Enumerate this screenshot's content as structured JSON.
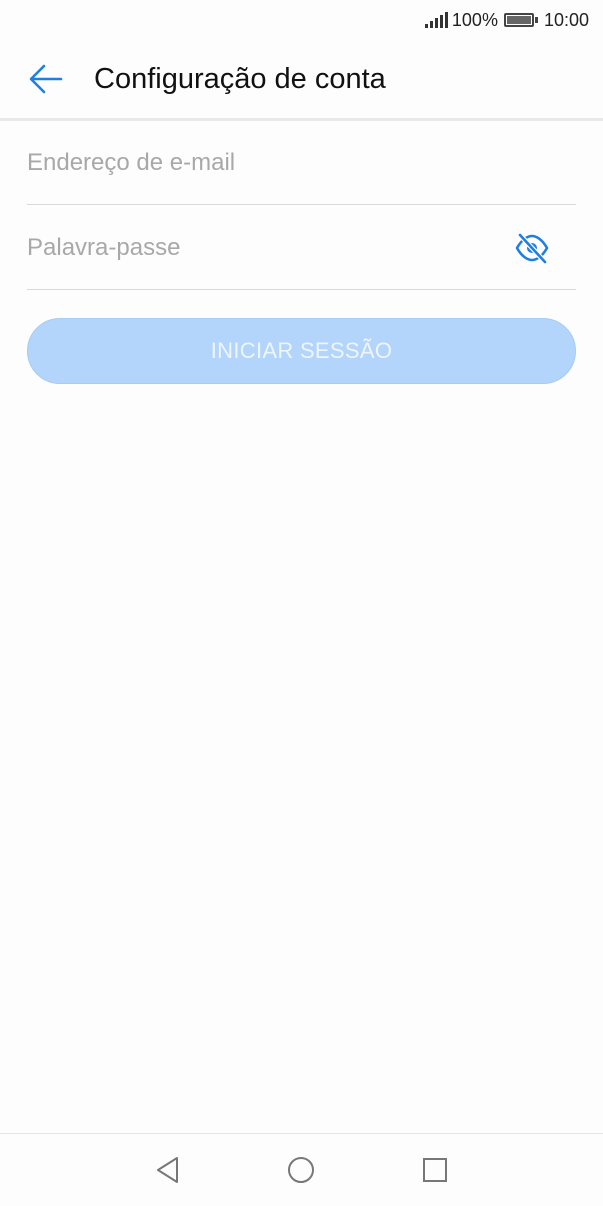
{
  "status_bar": {
    "battery_percent": "100%",
    "time": "10:00"
  },
  "header": {
    "title": "Configuração de conta",
    "back_icon": "arrow-left-icon"
  },
  "form": {
    "email": {
      "placeholder": "Endereço de e-mail",
      "value": ""
    },
    "password": {
      "placeholder": "Palavra-passe",
      "value": "",
      "toggle_icon": "eye-off-icon"
    },
    "login_label": "INICIAR SESSÃO"
  },
  "nav_bar": {
    "back_icon": "triangle-back-icon",
    "home_icon": "circle-home-icon",
    "recent_icon": "square-recent-icon"
  },
  "colors": {
    "accent": "#1f7fe0",
    "button_disabled": "#b3d5fb"
  }
}
